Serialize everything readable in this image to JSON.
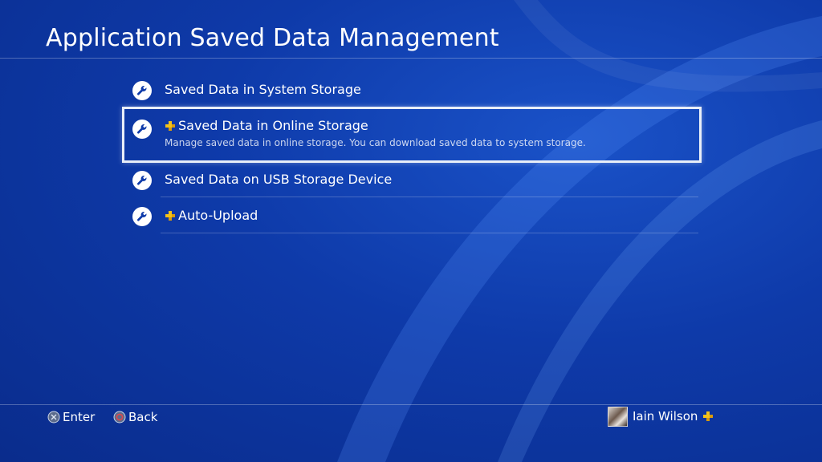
{
  "header": {
    "title": "Application Saved Data Management"
  },
  "menu": {
    "items": [
      {
        "label": "Saved Data in System Storage",
        "icon": "wrench-icon",
        "psplus": false,
        "selected": false
      },
      {
        "label": "Saved Data in Online Storage",
        "icon": "wrench-icon",
        "psplus": true,
        "selected": true,
        "description": "Manage saved data in online storage. You can download saved data to system storage."
      },
      {
        "label": "Saved Data on USB Storage Device",
        "icon": "wrench-icon",
        "psplus": false,
        "selected": false
      },
      {
        "label": "Auto-Upload",
        "icon": "wrench-icon",
        "psplus": true,
        "selected": false
      }
    ]
  },
  "footer": {
    "enter_label": "Enter",
    "enter_icon": "cross-button-icon",
    "back_label": "Back",
    "back_icon": "circle-button-icon",
    "user_name": "Iain Wilson",
    "user_psplus": true
  },
  "colors": {
    "background": "#0e3aa9",
    "psplus_gold": "#f2c21a",
    "selection_border": "#e8eef8"
  }
}
